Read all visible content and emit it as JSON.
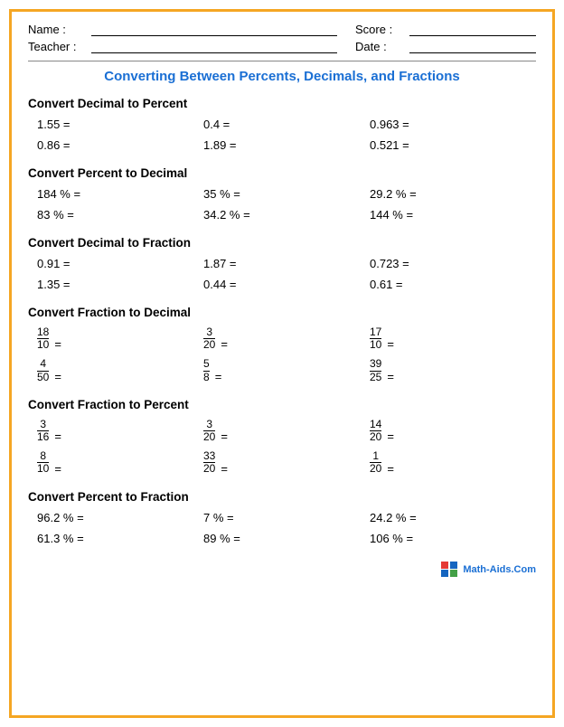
{
  "header": {
    "name_label": "Name :",
    "teacher_label": "Teacher :",
    "score_label": "Score :",
    "date_label": "Date :"
  },
  "title": "Converting Between Percents, Decimals, and Fractions",
  "sections": [
    {
      "id": "decimal-to-percent",
      "title": "Convert Decimal to Percent",
      "problems": [
        {
          "text": "1.55 =",
          "type": "plain"
        },
        {
          "text": "0.4 =",
          "type": "plain"
        },
        {
          "text": "0.963 =",
          "type": "plain"
        },
        {
          "text": "0.86 =",
          "type": "plain"
        },
        {
          "text": "1.89 =",
          "type": "plain"
        },
        {
          "text": "0.521 =",
          "type": "plain"
        }
      ]
    },
    {
      "id": "percent-to-decimal",
      "title": "Convert Percent to Decimal",
      "problems": [
        {
          "text": "184 % =",
          "type": "plain"
        },
        {
          "text": "35 % =",
          "type": "plain"
        },
        {
          "text": "29.2 % =",
          "type": "plain"
        },
        {
          "text": "83 % =",
          "type": "plain"
        },
        {
          "text": "34.2 % =",
          "type": "plain"
        },
        {
          "text": "144 % =",
          "type": "plain"
        }
      ]
    },
    {
      "id": "decimal-to-fraction",
      "title": "Convert Decimal to Fraction",
      "problems": [
        {
          "text": "0.91 =",
          "type": "plain"
        },
        {
          "text": "1.87 =",
          "type": "plain"
        },
        {
          "text": "0.723 =",
          "type": "plain"
        },
        {
          "text": "1.35 =",
          "type": "plain"
        },
        {
          "text": "0.44 =",
          "type": "plain"
        },
        {
          "text": "0.61 =",
          "type": "plain"
        }
      ]
    },
    {
      "id": "fraction-to-decimal",
      "title": "Convert Fraction to Decimal",
      "problems": [
        {
          "type": "fraction",
          "num": "18",
          "den": "10"
        },
        {
          "type": "fraction",
          "num": "3",
          "den": "20"
        },
        {
          "type": "fraction",
          "num": "17",
          "den": "10"
        },
        {
          "type": "fraction",
          "num": "4",
          "den": "50"
        },
        {
          "type": "fraction",
          "num": "5",
          "den": "8"
        },
        {
          "type": "fraction",
          "num": "39",
          "den": "25"
        }
      ]
    },
    {
      "id": "fraction-to-percent",
      "title": "Convert Fraction to Percent",
      "problems": [
        {
          "type": "fraction",
          "num": "3",
          "den": "16"
        },
        {
          "type": "fraction",
          "num": "3",
          "den": "20"
        },
        {
          "type": "fraction",
          "num": "14",
          "den": "20"
        },
        {
          "type": "fraction",
          "num": "8",
          "den": "10"
        },
        {
          "type": "fraction",
          "num": "33",
          "den": "20"
        },
        {
          "type": "fraction",
          "num": "1",
          "den": "20"
        }
      ]
    },
    {
      "id": "percent-to-fraction",
      "title": "Convert Percent to Fraction",
      "problems": [
        {
          "text": "96.2 % =",
          "type": "plain"
        },
        {
          "text": "7 % =",
          "type": "plain"
        },
        {
          "text": "24.2 % =",
          "type": "plain"
        },
        {
          "text": "61.3 % =",
          "type": "plain"
        },
        {
          "text": "89 % =",
          "type": "plain"
        },
        {
          "text": "106 % =",
          "type": "plain"
        }
      ]
    }
  ],
  "footer": {
    "logo_text": "Math-Aids.Com"
  }
}
